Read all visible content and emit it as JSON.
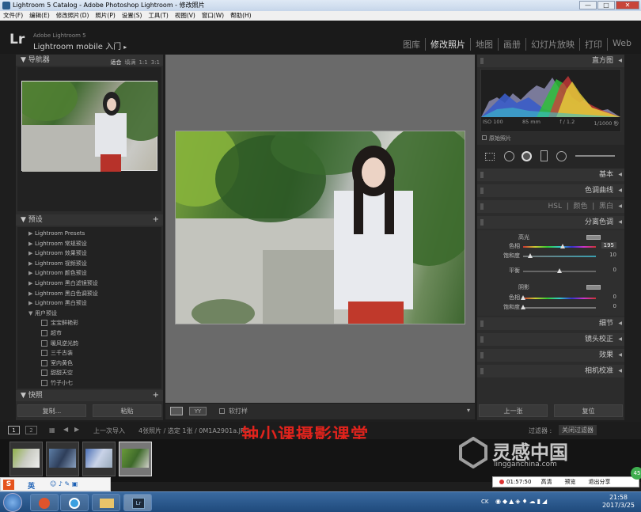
{
  "window": {
    "title": "Lightroom 5 Catalog - Adobe Photoshop Lightroom - 修改照片",
    "min": "—",
    "max": "□",
    "close": "✕"
  },
  "menu": [
    "文件(F)",
    "编辑(E)",
    "修改照片(D)",
    "照片(P)",
    "设置(S)",
    "工具(T)",
    "视图(V)",
    "窗口(W)",
    "帮助(H)"
  ],
  "identity": {
    "logo": "Lr",
    "product": "Adobe Lightroom 5",
    "mobile": "Lightroom mobile 入门",
    "arrow": "▸"
  },
  "modules": [
    {
      "label": "图库",
      "active": false
    },
    {
      "label": "修改照片",
      "active": true
    },
    {
      "label": "地图",
      "active": false
    },
    {
      "label": "画册",
      "active": false
    },
    {
      "label": "幻灯片放映",
      "active": false
    },
    {
      "label": "打印",
      "active": false
    },
    {
      "label": "Web",
      "active": false
    }
  ],
  "navigator": {
    "title": "导航器",
    "options": [
      "适合",
      "填满",
      "1:1",
      "3:1"
    ]
  },
  "presets": {
    "title": "预设",
    "add": "+",
    "items": [
      {
        "label": "Lightroom Presets",
        "sub": false
      },
      {
        "label": "Lightroom 常规预设",
        "sub": false
      },
      {
        "label": "Lightroom 效果预设",
        "sub": false
      },
      {
        "label": "Lightroom 视频预设",
        "sub": false
      },
      {
        "label": "Lightroom 颜色预设",
        "sub": false
      },
      {
        "label": "Lightroom 黑白滤镜预设",
        "sub": false
      },
      {
        "label": "Lightroom 黑白色调预设",
        "sub": false
      },
      {
        "label": "Lightroom 黑白预设",
        "sub": false
      },
      {
        "label": "用户预设",
        "sub": false,
        "open": true
      },
      {
        "label": "宝宝鲜艳彩",
        "sub": true
      },
      {
        "label": "超市",
        "sub": true
      },
      {
        "label": "暖风逆光韵",
        "sub": true
      },
      {
        "label": "三千古装",
        "sub": true
      },
      {
        "label": "室内黄色",
        "sub": true
      },
      {
        "label": "甜甜天空",
        "sub": true
      },
      {
        "label": "竹子小七",
        "sub": true
      }
    ]
  },
  "snapshots": {
    "title": "快照",
    "add": "+"
  },
  "left_buttons": {
    "copy": "复制...",
    "paste": "粘贴"
  },
  "toolbar": {
    "softproof": "软打样",
    "dropdown": "▾"
  },
  "histogram": {
    "title": "直方图",
    "iso": "ISO 100",
    "focal": "85 mm",
    "aperture": "f / 1.2",
    "shutter": "1/1000 秒",
    "original": "原始照片"
  },
  "panels": {
    "basic": "基本",
    "tone_curve": "色调曲线",
    "hsl": [
      "HSL",
      "颜色",
      "黑白"
    ],
    "split_toning": "分离色调",
    "detail": "细节",
    "lens": "镜头校正",
    "effects": "效果",
    "camera": "相机校准"
  },
  "split_toning": {
    "highlights_label": "高光",
    "hue_label": "色相",
    "hue_value": "195",
    "hue_fraction": 0.54,
    "saturation_label": "饱和度",
    "saturation_value": "10",
    "saturation_fraction": 0.1,
    "balance_label": "平衡",
    "balance_value": "0",
    "shadows_label": "阴影",
    "sh_hue_label": "色相",
    "sh_hue_value": "0",
    "sh_sat_label": "饱和度",
    "sh_sat_value": "0"
  },
  "right_buttons": {
    "prev": "上一张",
    "reset": "复位"
  },
  "filmstrip": {
    "pages": [
      "1",
      "2"
    ],
    "source": "上一次导入",
    "info": "4张照片 / 选定 1张 / 0M1A2901a.JPG",
    "filter_label": "过滤器 :",
    "filter_value": "关闭过滤器"
  },
  "watermark": "钟小课摄影课堂",
  "site_logo": {
    "name": "灵感中国",
    "url": "lingganchina.com"
  },
  "recorder": {
    "time": "01:57:50",
    "btns": [
      "高清",
      "预览",
      "退出分享"
    ],
    "badge": "45"
  },
  "ime": {
    "label": "英"
  },
  "clock": {
    "time": "21:58",
    "date": "2017/3/25",
    "lang": "CK"
  }
}
